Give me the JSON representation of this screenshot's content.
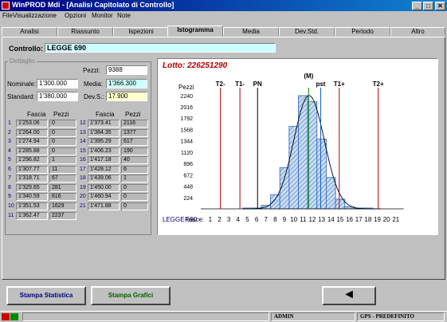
{
  "window": {
    "title": "WinPROD  Mdi - [Analisi Capitolato di Controllo]",
    "min_glyph": "_",
    "max_glyph": "□",
    "close_glyph": "✕"
  },
  "menu": [
    "File",
    "Visualizzazione",
    "Opzioni",
    "Monitor",
    "Note"
  ],
  "tabs": [
    "Analisi",
    "Riassunto",
    "Ispezioni",
    "Istogramma",
    "Media",
    "Dev.Std.",
    "Periodo",
    "Altro"
  ],
  "active_tab": 3,
  "controllo": {
    "label": "Controllo:",
    "value": "LEGGE 690"
  },
  "dettaglio": {
    "title": "Dettaglio",
    "pezzi_label": "Pezzi:",
    "pezzi_value": "9388",
    "nominale_label": "Nominale:",
    "nominale_value": "1'300.000",
    "media_label": "Media:",
    "media_value": "1'366.300",
    "standard_label": "Standard:",
    "standard_value": "1'380.000",
    "devs_label": "Dev.S.:",
    "devs_value": "17.900",
    "col_fascia": "Fascia",
    "col_pezzi": "Pezzi"
  },
  "rows_left": [
    {
      "n": "1",
      "fascia": "1'253.06",
      "pezzi": "0"
    },
    {
      "n": "2",
      "fascia": "1'264.00",
      "pezzi": "0"
    },
    {
      "n": "3",
      "fascia": "1'274.94",
      "pezzi": "0"
    },
    {
      "n": "4",
      "fascia": "1'285.88",
      "pezzi": "0"
    },
    {
      "n": "5",
      "fascia": "1'296.82",
      "pezzi": "1"
    },
    {
      "n": "6",
      "fascia": "1'307.77",
      "pezzi": "11"
    },
    {
      "n": "7",
      "fascia": "1'318.71",
      "pezzi": "67"
    },
    {
      "n": "8",
      "fascia": "1'329.65",
      "pezzi": "281"
    },
    {
      "n": "9",
      "fascia": "1'340.59",
      "pezzi": "816"
    },
    {
      "n": "10",
      "fascia": "1'351.53",
      "pezzi": "1629"
    },
    {
      "n": "11",
      "fascia": "1'362.47",
      "pezzi": "2237"
    }
  ],
  "rows_right": [
    {
      "n": "12",
      "fascia": "1'373.41",
      "pezzi": "2116"
    },
    {
      "n": "13",
      "fascia": "1'384.35",
      "pezzi": "1377"
    },
    {
      "n": "14",
      "fascia": "1'395.29",
      "pezzi": "617"
    },
    {
      "n": "15",
      "fascia": "1'406.23",
      "pezzi": "190"
    },
    {
      "n": "16",
      "fascia": "1'417.18",
      "pezzi": "40"
    },
    {
      "n": "17",
      "fascia": "1'428.12",
      "pezzi": "6"
    },
    {
      "n": "18",
      "fascia": "1'439.06",
      "pezzi": "1"
    },
    {
      "n": "19",
      "fascia": "1'450.00",
      "pezzi": "0"
    },
    {
      "n": "20",
      "fascia": "1'460.94",
      "pezzi": "0"
    },
    {
      "n": "21",
      "fascia": "1'471.88",
      "pezzi": "0"
    }
  ],
  "chart_data": {
    "type": "bar",
    "title": "Lotto: 226251290",
    "ylabel": "Pezzi",
    "xlabel": "Fasce:",
    "footer": "LEGGE 690",
    "categories": [
      "1",
      "2",
      "3",
      "4",
      "5",
      "6",
      "7",
      "8",
      "9",
      "10",
      "11",
      "12",
      "13",
      "14",
      "15",
      "16",
      "17",
      "18",
      "19",
      "20",
      "21"
    ],
    "values": [
      0,
      0,
      0,
      0,
      1,
      11,
      67,
      281,
      816,
      1629,
      2237,
      2116,
      1377,
      617,
      190,
      40,
      6,
      1,
      0,
      0,
      0
    ],
    "yticks": [
      224,
      448,
      672,
      896,
      1120,
      1344,
      1568,
      1792,
      2016,
      2240
    ],
    "ylim": [
      0,
      2300
    ],
    "normal_curve": {
      "mean_bin": 11.65,
      "sd_bins": 1.64
    },
    "vlines": [
      {
        "label": "T2-",
        "x": 2.1,
        "color": "#b00000"
      },
      {
        "label": "T1-",
        "x": 4.2,
        "color": "#b00000"
      },
      {
        "label": "PN",
        "x": 6.1,
        "color": "#000000"
      },
      {
        "label": "(M)",
        "x": 11.6,
        "color": "#008000"
      },
      {
        "label": "pst",
        "x": 12.9,
        "color": "#1060c0"
      },
      {
        "label": "T1+",
        "x": 14.9,
        "color": "#b00000"
      },
      {
        "label": "T2+",
        "x": 19.1,
        "color": "#b00000"
      }
    ],
    "colors": {
      "bar_fill": "#c8ddf0",
      "bar_edge": "#3060c0",
      "hatch": "#3060c0",
      "title": "#b00000",
      "curve": "#000000"
    }
  },
  "buttons": {
    "stampa_statistica": "Stampa Statistica",
    "stampa_grafici": "Stampa Grafici",
    "back_glyph": "◄"
  },
  "status": {
    "user": "ADMIN",
    "profile": "GPS - PREDEFINITO"
  }
}
